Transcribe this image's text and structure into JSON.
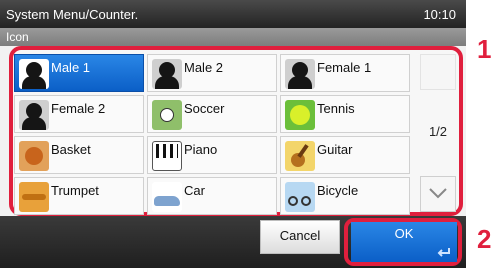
{
  "titlebar": {
    "title": "System Menu/Counter.",
    "time": "10:10"
  },
  "subtitle": "Icon",
  "icons": [
    {
      "label": "Male 1",
      "icon": "male-1-icon",
      "selected": true
    },
    {
      "label": "Male 2",
      "icon": "male-2-icon"
    },
    {
      "label": "Female 1",
      "icon": "female-1-icon"
    },
    {
      "label": "Female 2",
      "icon": "female-2-icon"
    },
    {
      "label": "Soccer",
      "icon": "soccer-icon"
    },
    {
      "label": "Tennis",
      "icon": "tennis-icon"
    },
    {
      "label": "Basket",
      "icon": "basket-icon"
    },
    {
      "label": "Piano",
      "icon": "piano-icon"
    },
    {
      "label": "Guitar",
      "icon": "guitar-icon"
    },
    {
      "label": "Trumpet",
      "icon": "trumpet-icon"
    },
    {
      "label": "Car",
      "icon": "car-icon"
    },
    {
      "label": "Bicycle",
      "icon": "bicycle-icon"
    }
  ],
  "pager": {
    "indicator": "1/2"
  },
  "buttons": {
    "cancel": "Cancel",
    "ok": "OK"
  },
  "markers": {
    "one": "1",
    "two": "2"
  },
  "colors": {
    "highlight": "#e01f3d",
    "selected": "#1a73d9"
  }
}
